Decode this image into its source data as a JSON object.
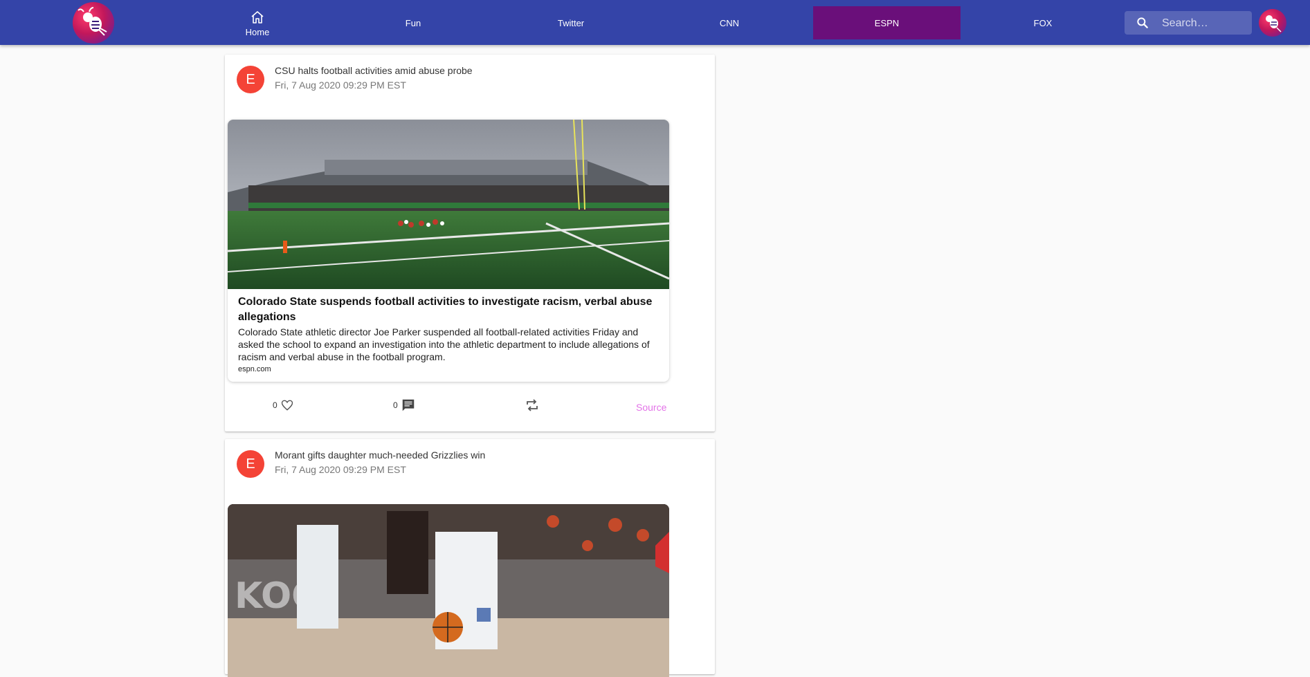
{
  "nav": {
    "home_label": "Home",
    "fun_label": "Fun",
    "twitter_label": "Twitter",
    "cnn_label": "CNN",
    "espn_label": "ESPN",
    "fox_label": "FOX",
    "active_tab": "ESPN",
    "search_placeholder": "Search…"
  },
  "colors": {
    "topbar": "#3444a8",
    "active_tab": "#6a0f7a",
    "post_avatar": "#f44336",
    "source_link": "#e373e8"
  },
  "posts": [
    {
      "avatar_letter": "E",
      "title": "CSU halts football activities amid abuse probe",
      "date": "Fri, 7 Aug 2020 09:29 PM EST",
      "preview": {
        "image": "football-stadium-photo",
        "headline": "Colorado State suspends football activities to investigate racism, verbal abuse allegations",
        "description": "Colorado State athletic director Joe Parker suspended all football-related activities Friday and asked the school to expand an investigation into the athletic department to include allegations of racism and verbal abuse in the football program.",
        "domain": "espn.com"
      },
      "likes": "0",
      "comments": "0",
      "source_label": "Source"
    },
    {
      "avatar_letter": "E",
      "title": "Morant gifts daughter much-needed Grizzlies win",
      "date": "Fri, 7 Aug 2020 09:29 PM EST",
      "preview": {
        "image": "basketball-game-photo"
      }
    }
  ]
}
